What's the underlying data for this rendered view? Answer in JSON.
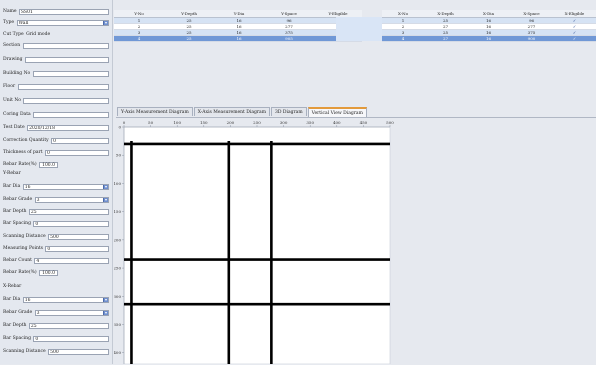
{
  "sidebar": {
    "name": {
      "label": "Name",
      "value": "SS01"
    },
    "type": {
      "label": "Type",
      "value": "Wall"
    },
    "cut_type": {
      "label": "Cut Type",
      "value": "Grid mode"
    },
    "section": {
      "label": "Section",
      "value": ""
    },
    "drawing": {
      "label": "Drawing",
      "value": ""
    },
    "building": {
      "label": "Building No",
      "value": ""
    },
    "floor": {
      "label": "Floor",
      "value": ""
    },
    "unit": {
      "label": "Unit No",
      "value": ""
    },
    "coring_data": {
      "label": "Coring Data",
      "value": ""
    },
    "test_date": {
      "label": "Test Date",
      "value": "2020/12/18"
    },
    "correction_qty": {
      "label": "Correction Quantity",
      "value": "0"
    },
    "thickness": {
      "label": "Thickness of part",
      "value": "0"
    },
    "rebar_ratio_top": {
      "label": "Rebar Rate(%)",
      "value": "100.0"
    },
    "section_y": "Y-Rebar",
    "y": {
      "bar_dia": {
        "label": "Bar Dia",
        "value": "16"
      },
      "rebar_grade": {
        "label": "Rebar Grade",
        "value": "3"
      },
      "bar_depth": {
        "label": "Bar Depth",
        "value": "25"
      },
      "bar_spacing": {
        "label": "Bar Spacing",
        "value": "0"
      },
      "scanning_dist": {
        "label": "Scanning Distance",
        "value": "500"
      },
      "measuring_points": {
        "label": "Measuring Points",
        "value": "0"
      },
      "rebar_count": {
        "label": "Rebar Count",
        "value": "4"
      },
      "rebar_ratio": {
        "label": "Rebar Rate(%)",
        "value": "100.0"
      }
    },
    "section_x": "X-Rebar",
    "x": {
      "bar_dia": {
        "label": "Bar Dia",
        "value": "16"
      },
      "rebar_grade": {
        "label": "Rebar Grade",
        "value": "3"
      },
      "bar_depth": {
        "label": "Bar Depth",
        "value": "25"
      },
      "bar_spacing": {
        "label": "Bar Spacing",
        "value": "0"
      },
      "scanning_dist": {
        "label": "Scanning Distance",
        "value": "500"
      }
    }
  },
  "table_left": {
    "headers": [
      "Y-No",
      "Y-Depth",
      "Y-Dia",
      "Y-Space",
      "Y-Eligible"
    ],
    "rows": [
      [
        "1",
        "25",
        "16",
        "96",
        "✓"
      ],
      [
        "2",
        "25",
        "16",
        "277",
        "✓"
      ],
      [
        "3",
        "25",
        "16",
        "375",
        "✓"
      ],
      [
        "4",
        "25",
        "16",
        "905",
        "✓"
      ]
    ]
  },
  "table_right": {
    "headers": [
      "X-No",
      "X-Depth",
      "X-Dia",
      "X-Space",
      "X-Eligible"
    ],
    "rows": [
      [
        "1",
        "25",
        "16",
        "96",
        "✓"
      ],
      [
        "2",
        "27",
        "16",
        "277",
        "✓"
      ],
      [
        "3",
        "25",
        "16",
        "375",
        "✓"
      ],
      [
        "4",
        "27",
        "16",
        "900",
        "✓"
      ]
    ]
  },
  "tabs": [
    "Y-Axis Measurement Diagram",
    "X-Axis Measurement Diagram",
    "3D Diagram",
    "Vertical View Diagram"
  ],
  "active_tab": 3,
  "plot": {
    "x_ticks": [
      "0",
      "50",
      "100",
      "150",
      "200",
      "250",
      "300",
      "350",
      "400",
      "450",
      "500"
    ],
    "y_ticks": [
      "0",
      "50",
      "100",
      "150",
      "200",
      "250",
      "300",
      "350",
      "400"
    ],
    "vertical_bars": [
      14,
      197,
      277
    ],
    "horizontal_bars": [
      30,
      235,
      314
    ],
    "x_range": [
      0,
      500
    ],
    "y_range": [
      0,
      420
    ]
  },
  "colors": {
    "selected_row": "#7098d6",
    "active_tab_accent": "#e39a3b",
    "rebar": "#000000"
  }
}
